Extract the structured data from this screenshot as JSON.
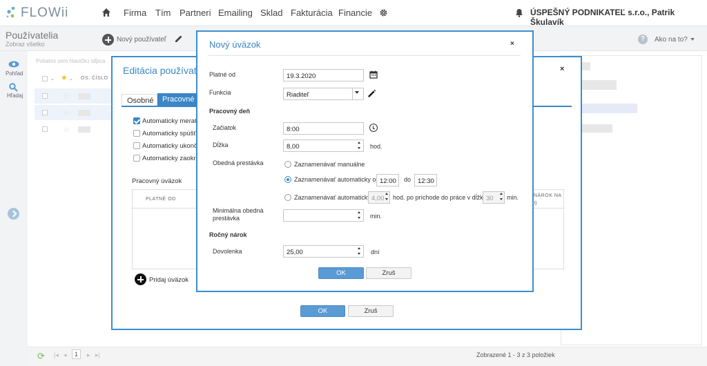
{
  "app": {
    "logo_text": "FLOWii",
    "nav": [
      "Firma",
      "Tím",
      "Partneri",
      "Emailing",
      "Sklad",
      "Fakturácia",
      "Financie"
    ],
    "company": "ÚSPEŠNÝ PODNIKATEĽ s.r.o., Patrik Škulavík"
  },
  "subheader": {
    "title": "Používatelia",
    "subtitle": "Zobraz všetko",
    "new_user": "Nový používateľ",
    "help": "Ako na to?"
  },
  "rail": {
    "view": "Pohľad",
    "search": "Hľadaj"
  },
  "table": {
    "drag_hint": "Potiahni sem hlavičku stĺpca",
    "col_number": "OS. ČÍSLO",
    "pager_page": "1",
    "shown": "Zobrazené 1 - 3 z 3 položiek"
  },
  "outer_modal": {
    "title": "Editácia používateľa",
    "tabs": [
      "Osobné",
      "Pracovné"
    ],
    "checkboxes": [
      {
        "label": "Automaticky merať čas",
        "checked": true
      },
      {
        "label": "Automaticky spúšťať",
        "checked": false
      },
      {
        "label": "Automaticky ukončovať",
        "checked": false
      },
      {
        "label": "Automaticky zaokrúhľovať",
        "checked": false
      }
    ],
    "uvazok_title": "Pracovný úväzok",
    "col_platne_od": "PLATNÉ OD",
    "col_narok": "NÁROK NA",
    "col_narok2": "(I)",
    "add_label": "Pridaj úväzok",
    "ok": "OK",
    "cancel": "Zruš"
  },
  "inner_modal": {
    "title": "Nový úväzok",
    "close": "×",
    "platne_od_label": "Platné od",
    "platne_od_value": "19.3.2020",
    "funkcia_label": "Funkcia",
    "funkcia_value": "Riaditeľ",
    "pracovny_den": "Pracovný deň",
    "zaciatok_label": "Začiatok",
    "zaciatok_value": "8:00",
    "dlzka_label": "Dĺžka",
    "dlzka_value": "8,00",
    "dlzka_unit": "hod.",
    "obedna_label": "Obedná prestávka",
    "radio_manual": "Zaznamenávať manuálne",
    "radio_auto_od": "Zaznamenávať automaticky od",
    "auto_od_value": "12:00",
    "do_label": "do",
    "auto_do_value": "12:30",
    "radio_auto": "Zaznamenávať automaticky",
    "auto_hours_value": "4,00",
    "auto_after_text": "hod. po príchode do práce v dĺžke",
    "auto_min_value": "30",
    "min_unit": "min.",
    "min_obedna_label_1": "Minimálna obedná",
    "min_obedna_label_2": "prestávka",
    "min_obedna_value": "",
    "min_obedna_unit": "min.",
    "rocny_narok": "Ročný nárok",
    "dovolenka_label": "Dovolenka",
    "dovolenka_value": "25,00",
    "dovolenka_unit": "dní",
    "ok": "OK",
    "cancel": "Zruš"
  },
  "colors": {
    "accent": "#3a86c8",
    "button_ok": "#5b9bd5"
  }
}
